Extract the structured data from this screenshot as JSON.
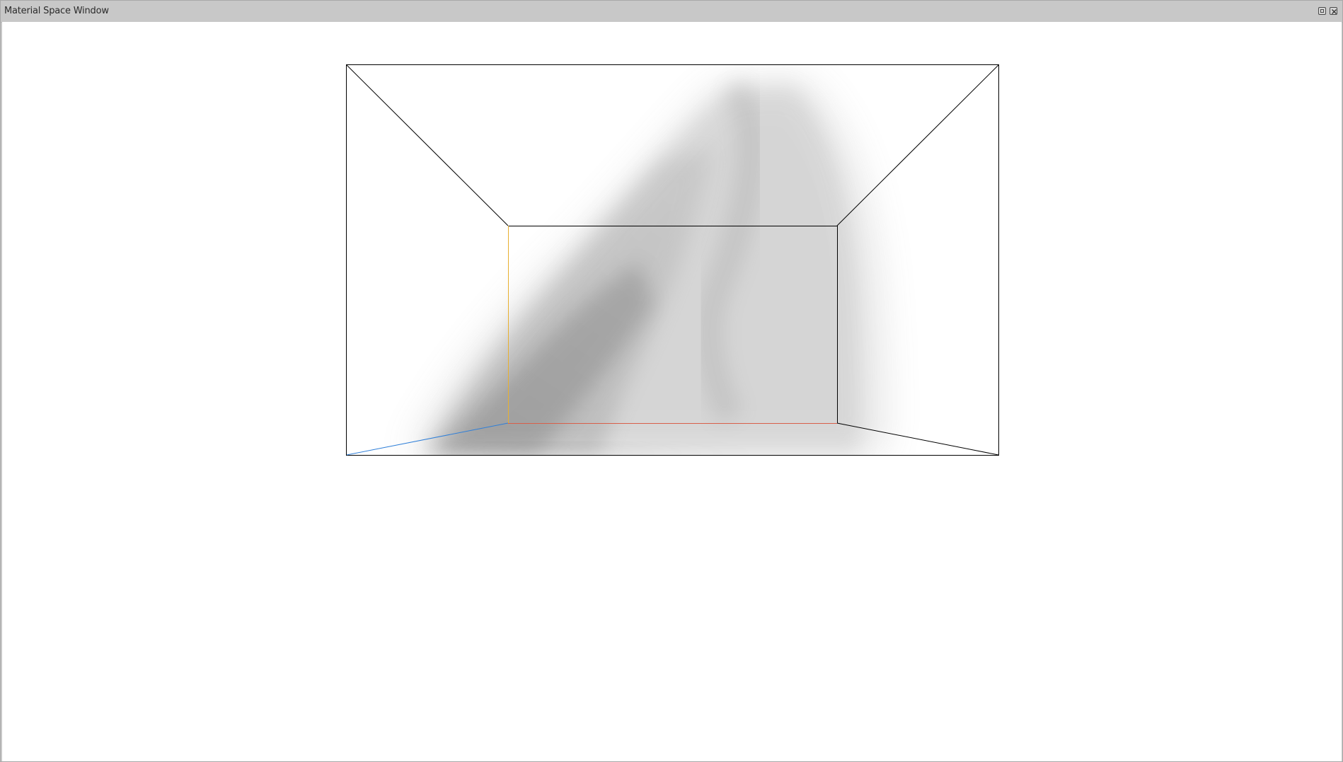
{
  "window": {
    "title": "Material Space Window",
    "float_icon": "float-icon",
    "close_icon": "close-icon"
  },
  "scene": {
    "box_edge_color": "#000000",
    "x_axis_color": "#d9604a",
    "y_axis_color": "#e8b030",
    "z_axis_color": "#2f7fd8",
    "cloud_color": "#6e6e6e"
  }
}
